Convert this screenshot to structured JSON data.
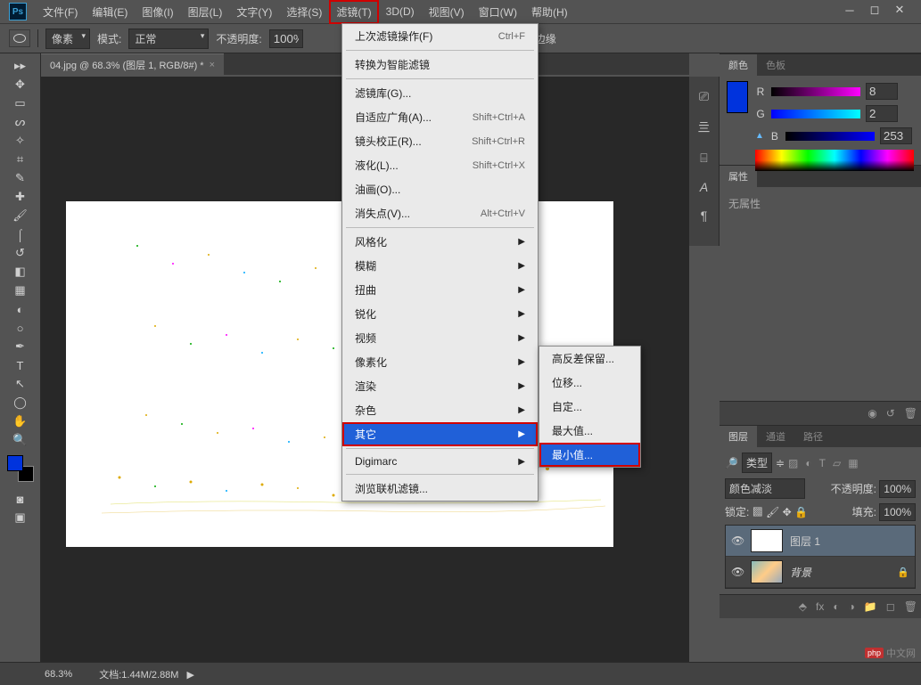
{
  "app": {
    "logo": "Ps"
  },
  "menubar": {
    "items": [
      "文件(F)",
      "编辑(E)",
      "图像(I)",
      "图层(L)",
      "文字(Y)",
      "选择(S)",
      "滤镜(T)",
      "3D(D)",
      "视图(V)",
      "窗口(W)",
      "帮助(H)"
    ],
    "highlighted_index": 6
  },
  "optionsbar": {
    "shape_type": "像素",
    "mode_label": "模式:",
    "mode_value": "正常",
    "opacity_label": "不透明度:",
    "opacity_value": "100%",
    "align_label": "对齐边缘"
  },
  "doc_tab": {
    "title": "04.jpg @ 68.3% (图层 1, RGB/8#) *"
  },
  "filter_menu": {
    "last_filter": {
      "label": "上次滤镜操作(F)",
      "shortcut": "Ctrl+F"
    },
    "smart": "转换为智能滤镜",
    "items1": [
      {
        "label": "滤镜库(G)...",
        "shortcut": ""
      },
      {
        "label": "自适应广角(A)...",
        "shortcut": "Shift+Ctrl+A"
      },
      {
        "label": "镜头校正(R)...",
        "shortcut": "Shift+Ctrl+R"
      },
      {
        "label": "液化(L)...",
        "shortcut": "Shift+Ctrl+X"
      },
      {
        "label": "油画(O)...",
        "shortcut": ""
      },
      {
        "label": "消失点(V)...",
        "shortcut": "Alt+Ctrl+V"
      }
    ],
    "groups": [
      "风格化",
      "模糊",
      "扭曲",
      "锐化",
      "视频",
      "像素化",
      "渲染",
      "杂色",
      "其它"
    ],
    "digimarc": "Digimarc",
    "browse": "浏览联机滤镜..."
  },
  "submenu": {
    "items": [
      "高反差保留...",
      "位移...",
      "自定...",
      "最大值...",
      "最小值..."
    ],
    "selected_index": 4
  },
  "color_panel": {
    "tab1": "颜色",
    "tab2": "色板",
    "r_label": "R",
    "g_label": "G",
    "b_label": "B",
    "r_val": "8",
    "g_val": "2",
    "b_val": "253"
  },
  "props_panel": {
    "tab": "属性",
    "text": "无属性"
  },
  "layers_panel": {
    "tab1": "图层",
    "tab2": "通道",
    "tab3": "路径",
    "kind_label": "类型",
    "blend_mode": "颜色减淡",
    "opacity_label": "不透明度:",
    "opacity_value": "100%",
    "lock_label": "锁定:",
    "fill_label": "填充:",
    "fill_value": "100%",
    "layer1_name": "图层 1",
    "bg_name": "背景"
  },
  "statusbar": {
    "zoom": "68.3%",
    "doc_label": "文档:",
    "doc_size": "1.44M/2.88M"
  },
  "watermark": {
    "brand": "php",
    "text": "中文网"
  }
}
